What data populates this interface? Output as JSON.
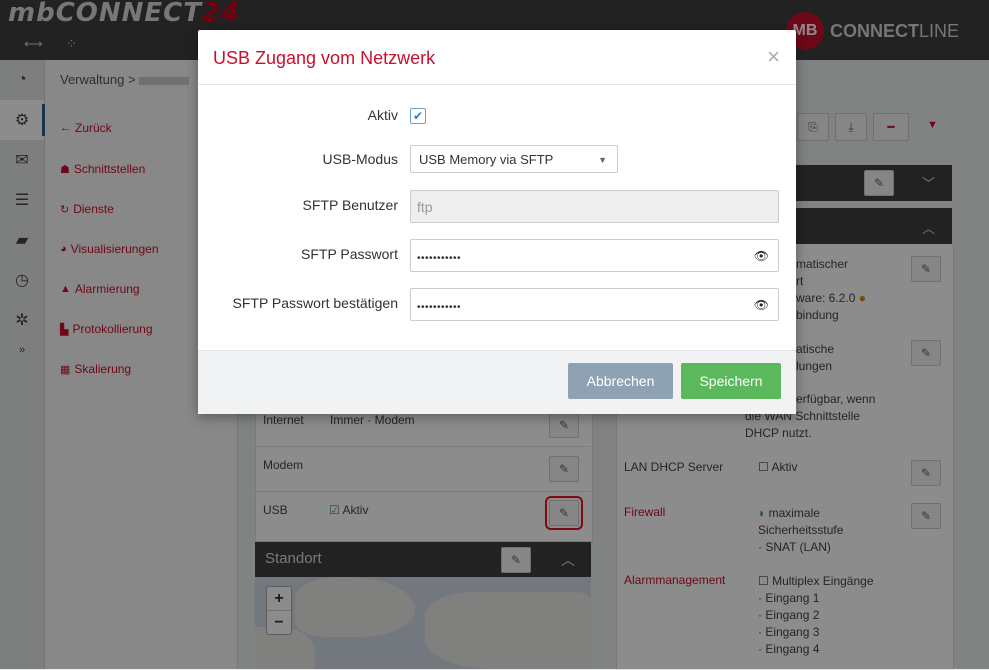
{
  "app": {
    "logo_prefix": "mbCONNECT",
    "logo_number": "24",
    "brand_badge": "MB",
    "brand_name_bold": "CONNECT",
    "brand_name_light": "LINE"
  },
  "breadcrumb": {
    "root": "Verwaltung",
    "separator": ">"
  },
  "sidebar": {
    "items": [
      {
        "label": "Zurück",
        "icon": "arrow-left-icon"
      },
      {
        "label": "Schnittstellen",
        "icon": "sitemap-icon"
      },
      {
        "label": "Dienste",
        "icon": "refresh-icon"
      },
      {
        "label": "Visualisierungen",
        "icon": "dashboard-icon"
      },
      {
        "label": "Alarmierung",
        "icon": "warning-icon"
      },
      {
        "label": "Protokollierung",
        "icon": "area-chart-icon"
      },
      {
        "label": "Skalierung",
        "icon": "calculator-icon"
      }
    ]
  },
  "background": {
    "left_rows": {
      "internet_label": "Internet",
      "internet_value": "Immer · Modem",
      "modem_label": "Modem",
      "usb_label": "USB",
      "usb_value": "Aktiv"
    },
    "standort_title": "Standort",
    "right_rows": {
      "auto_update_partial": [
        "matischer",
        "rt",
        "ware: 6.2.0",
        "bindung"
      ],
      "auto_settings_partial": [
        "atische",
        "lungen"
      ],
      "wan_note": [
        "erfügbar, wenn",
        "die WAN Schnittstelle",
        "DHCP nutzt."
      ],
      "lan_dhcp_label": "LAN DHCP Server",
      "lan_dhcp_value": "Aktiv",
      "firewall_label": "Firewall",
      "firewall_value": [
        "maximale",
        "Sicherheitsstufe",
        "· SNAT (LAN)"
      ],
      "alarm_label": "Alarmmanagement",
      "alarm_values": [
        "Multiplex Eingänge",
        "· Eingang 1",
        "· Eingang 2",
        "· Eingang 3",
        "· Eingang 4"
      ]
    }
  },
  "modal": {
    "title": "USB Zugang vom Netzwerk",
    "close": "×",
    "fields": {
      "aktiv_label": "Aktiv",
      "usb_mode_label": "USB-Modus",
      "usb_mode_value": "USB Memory via SFTP",
      "sftp_user_label": "SFTP Benutzer",
      "sftp_user_value": "ftp",
      "sftp_pass_label": "SFTP Passwort",
      "sftp_pass_value": "•••••••••••",
      "sftp_pass_confirm_label": "SFTP Passwort bestätigen",
      "sftp_pass_confirm_value": "•••••••••••"
    },
    "buttons": {
      "cancel": "Abbrechen",
      "save": "Speichern"
    }
  },
  "colors": {
    "accent_red": "#c8102e",
    "save_green": "#5cb85c",
    "cancel_gray": "#8fa2b3"
  }
}
